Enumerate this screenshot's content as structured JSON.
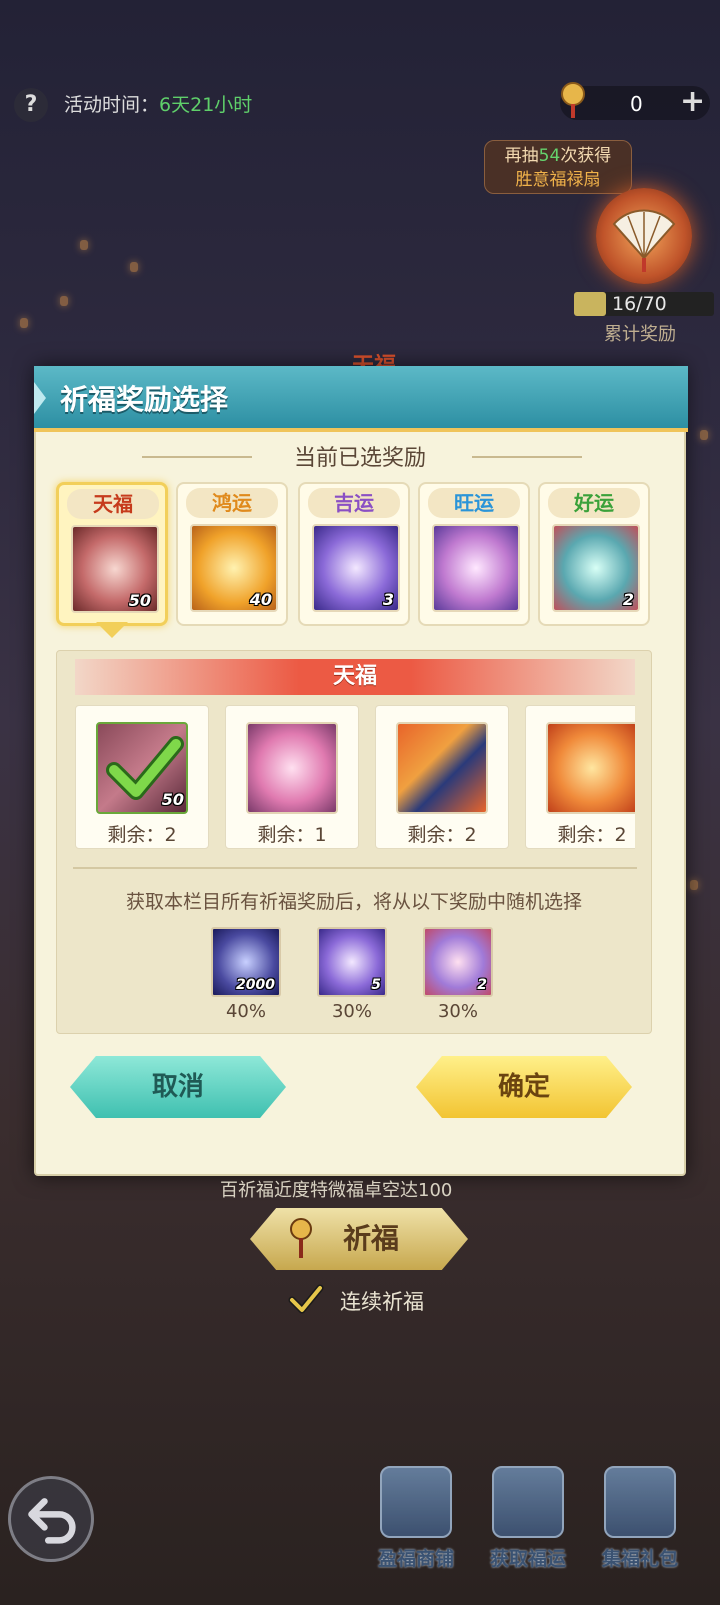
{
  "header": {
    "help_icon": "question-mark-icon",
    "activity_label": "活动时间：",
    "activity_value": "6天21小时",
    "currency_value": "0",
    "currency_icon": "lucky-charm-icon",
    "plus_icon": "plus-icon"
  },
  "bonus": {
    "tip_prefix": "再抽",
    "tip_count": "54",
    "tip_suffix": "次获得",
    "tip_item": "胜意福禄扇",
    "progress": "16/70",
    "progress_fraction": 0.2286,
    "accum_label": "累计奖励",
    "background_tier": "天福"
  },
  "modal": {
    "title": "祈福奖励选择",
    "subtitle": "当前已选奖励",
    "tiers": [
      {
        "label": "天福",
        "count": "50",
        "color": "#c63b1c",
        "selected": true
      },
      {
        "label": "鸿运",
        "count": "40",
        "color": "#e08a1c",
        "selected": false
      },
      {
        "label": "吉运",
        "count": "3",
        "color": "#8a4fc4",
        "selected": false
      },
      {
        "label": "旺运",
        "count": "",
        "color": "#2a94d8",
        "selected": false
      },
      {
        "label": "好运",
        "count": "2",
        "color": "#3aa13a",
        "selected": false
      }
    ],
    "pool": {
      "banner": "天福",
      "items": [
        {
          "remain": "剩余：2",
          "count": "50",
          "chosen": true
        },
        {
          "remain": "剩余：1",
          "count": "",
          "chosen": false
        },
        {
          "remain": "剩余：2",
          "count": "",
          "chosen": false
        },
        {
          "remain": "剩余：2",
          "count": "",
          "chosen": false
        }
      ],
      "description": "获取本栏目所有祈福奖励后，将从以下奖励中随机选择",
      "random": [
        {
          "count": "2000",
          "percent": "40%"
        },
        {
          "count": "5",
          "percent": "30%"
        },
        {
          "count": "2",
          "percent": "30%"
        }
      ]
    },
    "cancel_label": "取消",
    "confirm_label": "确定"
  },
  "bottom": {
    "hint": "百祈福近度特微福卓空达100",
    "pray_label": "祈福",
    "continuous_label": "连续祈福",
    "back_icon": "back-arrow-icon",
    "shops": [
      {
        "label": "盈福商铺",
        "icon": "shop-icon"
      },
      {
        "label": "获取福运",
        "icon": "cards-icon"
      },
      {
        "label": "集福礼包",
        "icon": "gift-icon"
      }
    ]
  }
}
